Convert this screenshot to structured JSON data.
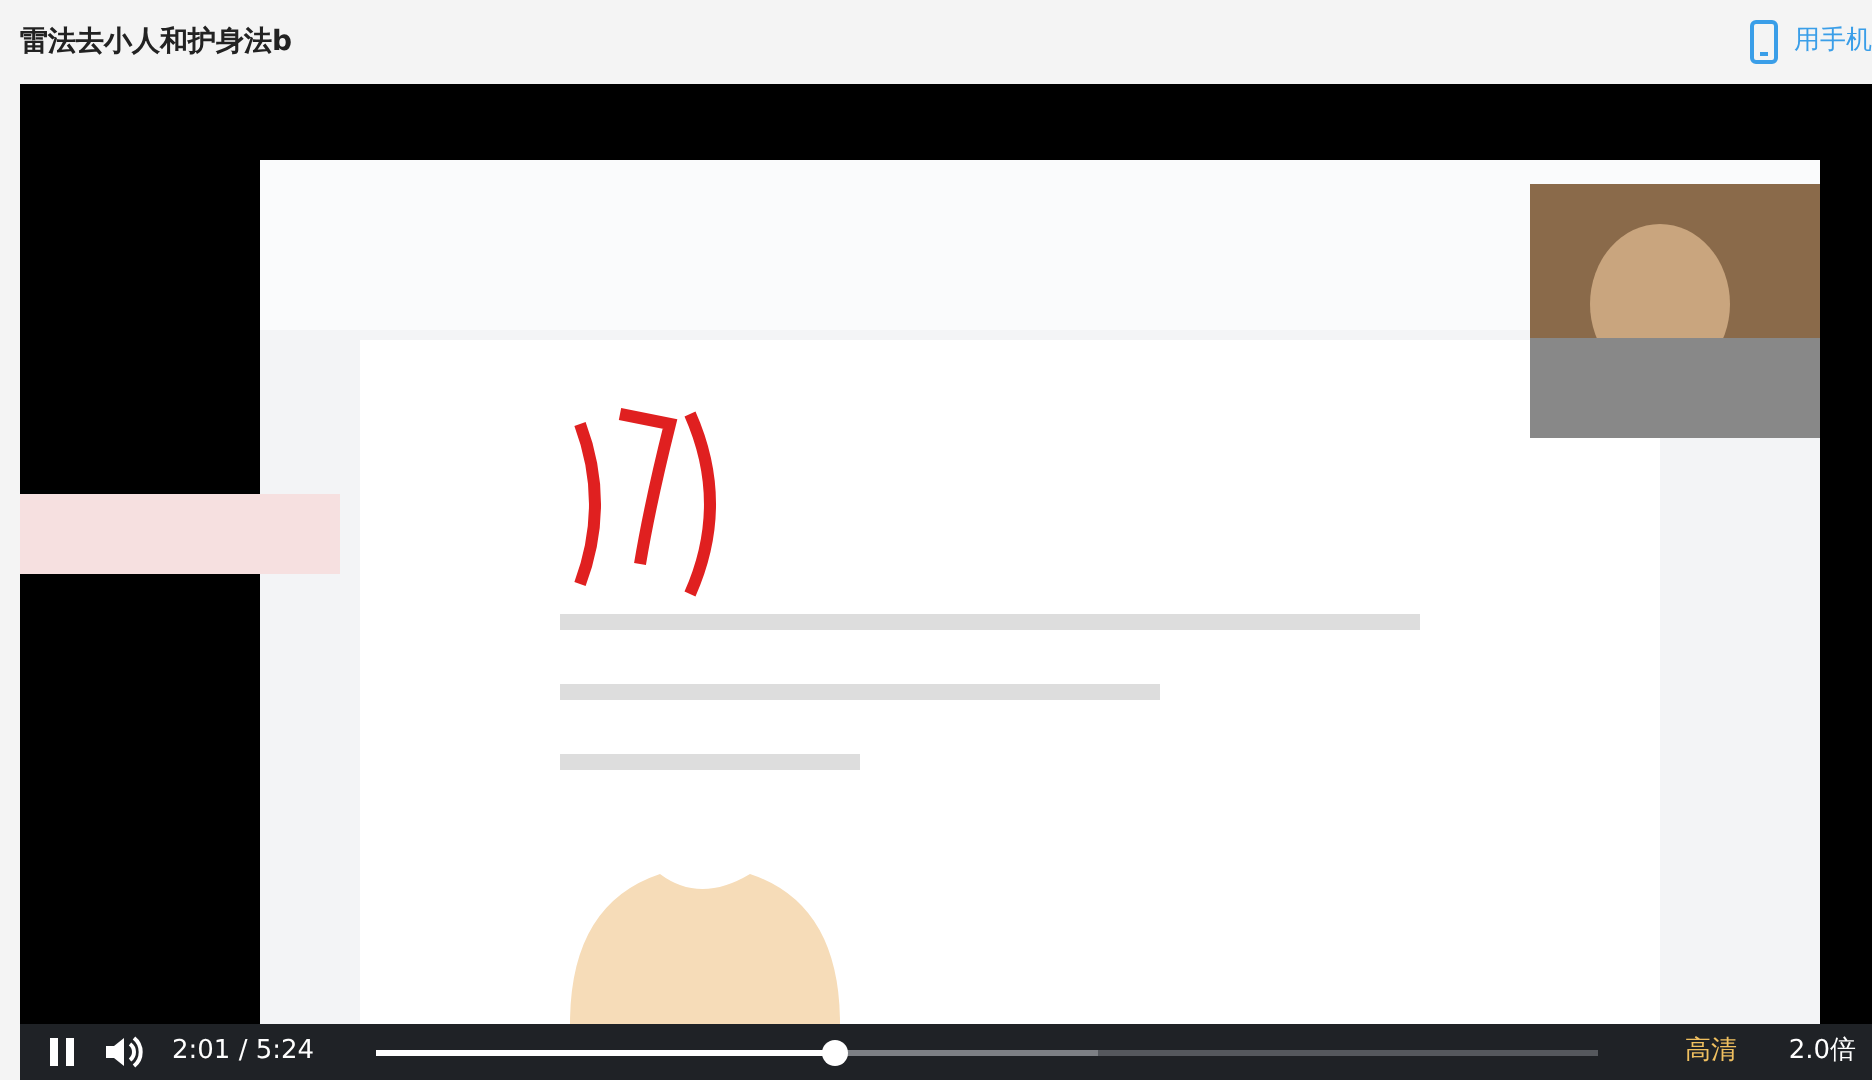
{
  "page": {
    "title": "雷法去小人和护身法b",
    "mobile_link": "用手机"
  },
  "controls": {
    "playing": true,
    "time": "2:01 / 5:24",
    "progress": {
      "level": 0.374
    },
    "buffered": {
      "level": 0.59
    },
    "quality": "高清",
    "speed": "2.0倍"
  }
}
